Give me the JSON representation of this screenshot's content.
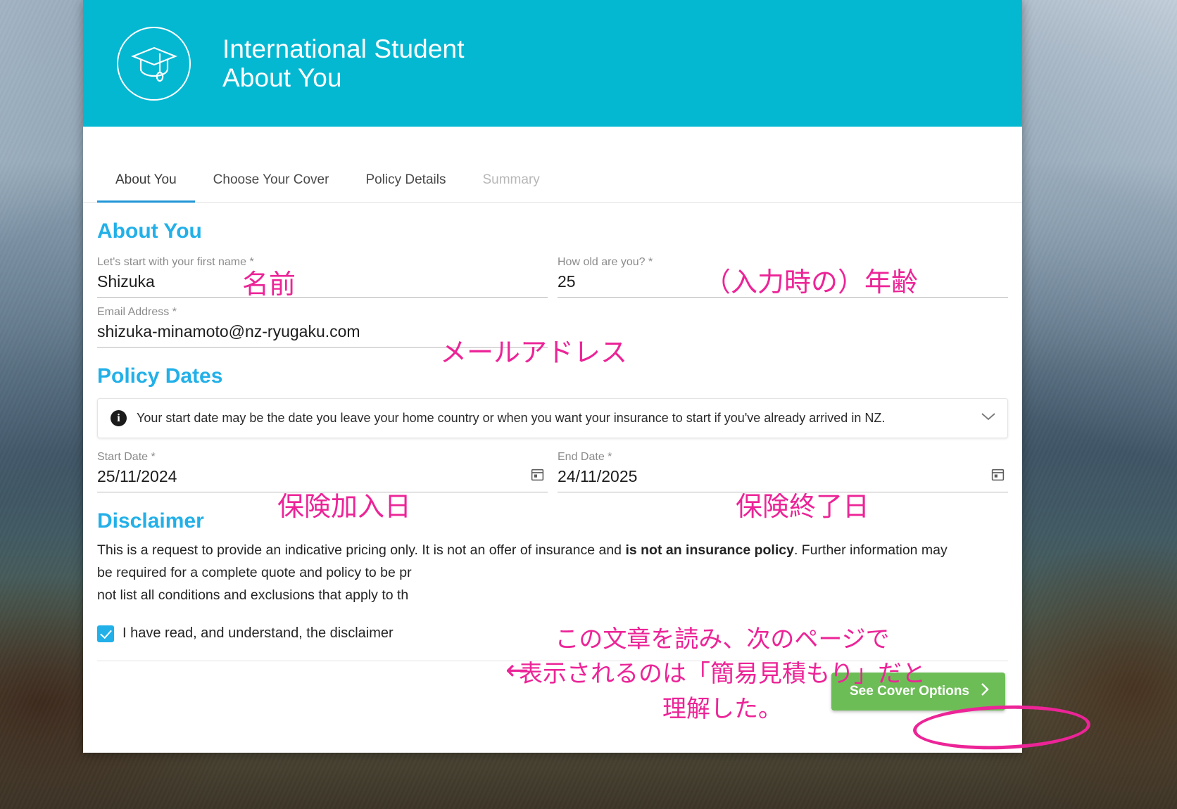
{
  "header": {
    "logo_icon": "graduation-cap-icon",
    "line1": "International Student",
    "line2": "About You"
  },
  "tabs": [
    {
      "label": "About You",
      "state": "active"
    },
    {
      "label": "Choose Your Cover",
      "state": "enabled"
    },
    {
      "label": "Policy Details",
      "state": "enabled"
    },
    {
      "label": "Summary",
      "state": "disabled"
    }
  ],
  "about_you": {
    "heading": "About You",
    "first_name": {
      "label": "Let's start with your first name *",
      "value": "Shizuka"
    },
    "age": {
      "label": "How old are you? *",
      "value": "25"
    },
    "email": {
      "label": "Email Address *",
      "value": "shizuka-minamoto@nz-ryugaku.com"
    }
  },
  "policy_dates": {
    "heading": "Policy Dates",
    "info_icon": "info-icon",
    "info_text": "Your start date may be the date you leave your home country or when you want your insurance to start if you've already arrived in NZ.",
    "expand_icon": "chevron-down-icon",
    "start_date": {
      "label": "Start Date *",
      "value": "25/11/2024",
      "icon": "calendar-icon"
    },
    "end_date": {
      "label": "End Date *",
      "value": "24/11/2025",
      "icon": "calendar-icon"
    }
  },
  "disclaimer": {
    "heading": "Disclaimer",
    "line1_a": "This is a request to provide an indicative pricing only. It is not an offer of insurance and ",
    "line1_bold": "is not an insurance policy",
    "line1_b": ". Further information may",
    "line2": "be required for a complete quote and policy to be pr",
    "line3": "not list all conditions and exclusions that apply to th",
    "checkbox_label": "I have read, and understand, the disclaimer",
    "checkbox_checked": "true"
  },
  "footer": {
    "cta_label": "See Cover Options",
    "cta_icon": "chevron-right-icon",
    "cta_color": "#6dbd57"
  },
  "annotations": {
    "color": "#ec2497",
    "name": "名前",
    "age": "（入力時の）年齢",
    "email": "メールアドレス",
    "start_date": "保険加入日",
    "end_date": "保険終了日",
    "arrow_left": "←",
    "note_line1": "この文章を読み、次のページで",
    "note_line2": "表示されるのは「簡易見積もり」だと",
    "note_line3": "理解した。"
  },
  "theme": {
    "header_bg": "#04b8d2",
    "section_heading": "#22b0e8",
    "tab_underline": "#2196d6",
    "cta_green": "#6dbd57",
    "annotation_pink": "#ec2497"
  }
}
